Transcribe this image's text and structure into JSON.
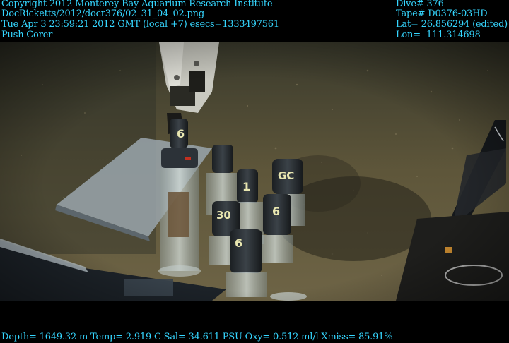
{
  "header": {
    "copyright": "Copyright 2012 Monterey Bay Aquarium Research Institute",
    "file_path": "DocRicketts/2012/docr376/02_31_04_02.png",
    "timestamp": "Tue Apr  3 23:59:21 2012 GMT (local +7)  esecs=1333497561",
    "activity": "Push Corer",
    "dive": "Dive# 376",
    "tape": "Tape# D0376-03HD",
    "lat": "Lat= 26.856294 (edited)",
    "lon": "Lon= -111.314698"
  },
  "footer": {
    "sensors": "Depth= 1649.32 m  Temp= 2.919 C  Sal= 34.611 PSU  Oxy= 0.512 ml/l  Xmiss= 85.91%"
  },
  "scene": {
    "core_labels": [
      "6",
      "1",
      "GC",
      "30",
      "6",
      "6"
    ]
  },
  "colors": {
    "overlay_text": "#35d6ff",
    "seafloor": "#5a5236"
  }
}
